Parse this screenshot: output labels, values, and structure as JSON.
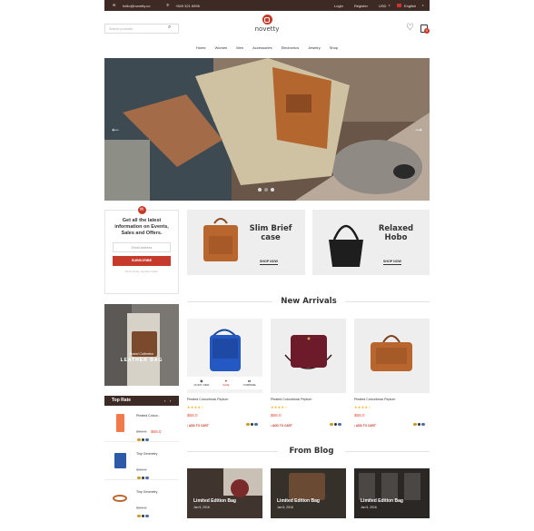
{
  "topbar": {
    "email": "hello@novetty.co",
    "phone": "+849 321 6996",
    "login": "Login",
    "register": "Register",
    "currency": "USD",
    "language": "English"
  },
  "logo": {
    "text": "novetty"
  },
  "search": {
    "placeholder": "Search products"
  },
  "nav": {
    "items": [
      "Home",
      "Women",
      "Men",
      "Accessories",
      "Electronics",
      "Jewelry",
      "Shop"
    ]
  },
  "newsletter": {
    "text": "Get all the latest information on Events, Sales and Offers.",
    "placeholder": "Email address",
    "button": "SUBSCRIBE",
    "note": "Don't worry, we don't spam"
  },
  "promos": [
    {
      "title_line1": "Slim Brief",
      "title_line2": "case",
      "cta": "SHOP NOW"
    },
    {
      "title_line1": "Relaxed",
      "title_line2": "Hobo",
      "cta": "SHOP NOW"
    }
  ],
  "banner": {
    "line1": "Brand Collection",
    "line2": "LEATHER BAG"
  },
  "top_rate": {
    "title": "Top Rate",
    "items": [
      {
        "name": "Pleated Colour..",
        "old": "$58.0",
        "new": "$68.0"
      },
      {
        "name": "Tiny Geometry",
        "old": "$58.0",
        "new": ""
      },
      {
        "name": "Tiny Geometry",
        "old": "$58.0",
        "new": ""
      }
    ]
  },
  "new_arrivals": {
    "title": "New Arrivals",
    "actions": [
      "QUICK VIEW",
      "SAVE",
      "COMPARE"
    ],
    "products": [
      {
        "name": "Pleated Colourblock Peplum",
        "price": "$68.0",
        "cta": "ADD TO CART"
      },
      {
        "name": "Pleated Colourblock Peplum",
        "price": "$68.0",
        "cta": "ADD TO CART"
      },
      {
        "name": "Pleated Colourblock Peplum",
        "price": "$68.0",
        "cta": "ADD TO CART"
      }
    ]
  },
  "blog": {
    "title": "From Blog",
    "posts": [
      {
        "title": "Limited Edition Bag",
        "date": "Jan 5, 2016"
      },
      {
        "title": "Limited Edition Bag",
        "date": "Jan 5, 2016"
      },
      {
        "title": "Limited Edition Bag",
        "date": "Jan 5, 2016"
      }
    ]
  },
  "cart": {
    "count": "0"
  },
  "colors": {
    "topbar": "#3e2a24",
    "accent": "#c53a2a",
    "sidebar_header": "#3e2a24"
  }
}
